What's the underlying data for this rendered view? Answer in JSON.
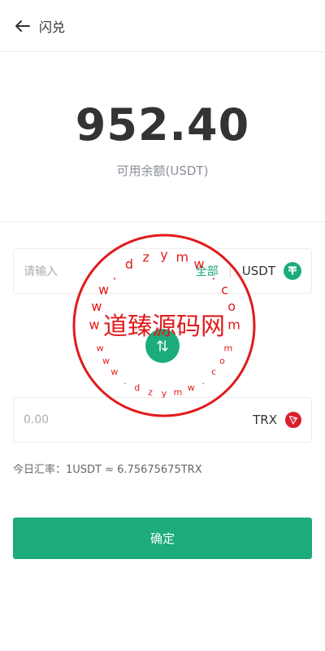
{
  "header": {
    "title": "闪兑",
    "back_icon": "arrow-left-icon"
  },
  "balance": {
    "amount": "952.40",
    "label": "可用余额(USDT)"
  },
  "from": {
    "placeholder": "请输入",
    "all_label": "全部",
    "coin": "USDT",
    "icon": "usdt-tether-icon",
    "icon_color": "#1bab7c"
  },
  "swap": {
    "icon": "swap-arrows-icon",
    "color": "#1bab7c"
  },
  "to": {
    "value": "0.00",
    "coin": "TRX",
    "icon": "tron-icon",
    "icon_color": "#d91f2b"
  },
  "rate": {
    "text": "今日汇率：1USDT ≈ 6.75675675TRX"
  },
  "confirm": {
    "label": "确定"
  },
  "watermark": {
    "center_text": "道臻源码网",
    "top_chars": [
      "w",
      "w",
      "w",
      ".",
      "d",
      "z",
      "y",
      "m",
      "w",
      ".",
      "c",
      "o",
      "m"
    ],
    "bottom_chars": [
      "w",
      "w",
      "w",
      ".",
      "d",
      "z",
      "y",
      "m",
      "w",
      ".",
      "c",
      "o",
      "m"
    ],
    "color": "#e01b1b"
  },
  "colors": {
    "accent": "#1bab7c",
    "muted": "#8a8f98",
    "text": "#333333"
  }
}
